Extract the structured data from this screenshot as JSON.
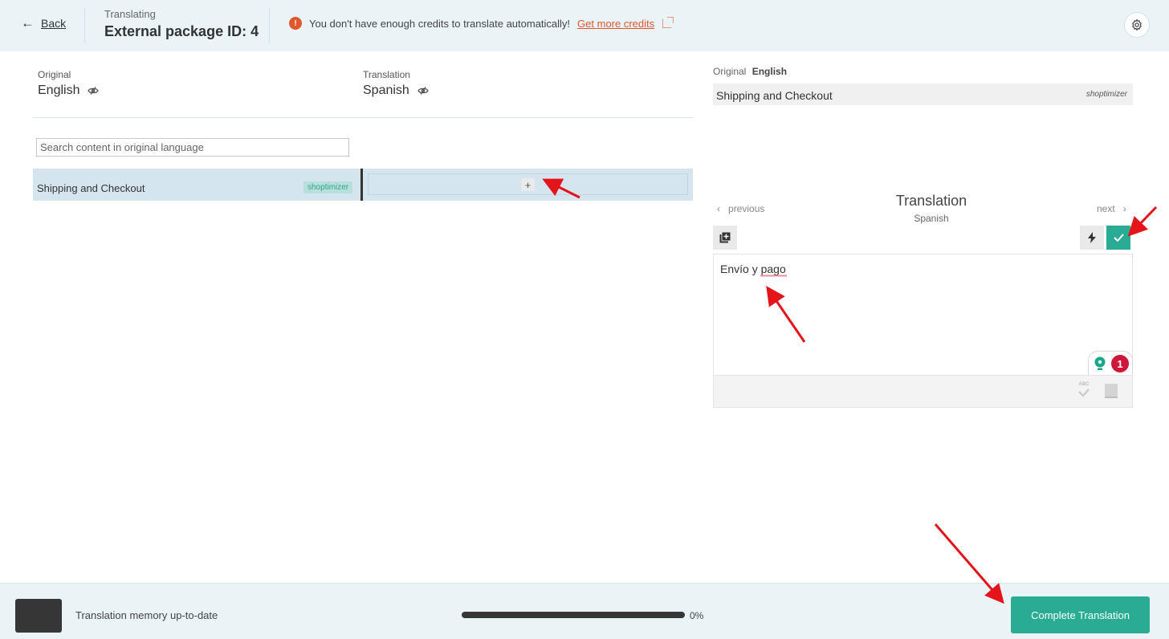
{
  "header": {
    "back_label": "Back",
    "subtitle": "Translating",
    "title": "External package ID: 4",
    "warning_text": "You don't have enough credits to translate automatically!",
    "warning_link": "Get more credits",
    "warning_icon": "!"
  },
  "left": {
    "original_caption": "Original",
    "original_language": "English",
    "translation_caption": "Translation",
    "translation_language": "Spanish",
    "search_placeholder": "Search content in original language",
    "rows": [
      {
        "source": "Shipping and Checkout",
        "tag": "shoptimizer",
        "target": "",
        "add_label": "+"
      }
    ]
  },
  "right": {
    "original_caption": "Original",
    "original_language": "English",
    "original_text": "Shipping and Checkout",
    "context": "shoptimizer",
    "prev_label": "previous",
    "next_label": "next",
    "translation_title": "Translation",
    "translation_language": "Spanish",
    "translation_value": "Envío y pago",
    "grammar_issue_count": "1",
    "spellcheck_label": "ABC"
  },
  "footer": {
    "memory_status": "Translation memory up-to-date",
    "progress_percent": 0,
    "progress_label": "0%",
    "complete_label": "Complete Translation"
  },
  "colors": {
    "accent": "#2aac94",
    "warning": "#e0562e",
    "header_bg": "#eaf3f6",
    "selected_row": "#d4e5ef",
    "error_badge": "#d0173b"
  }
}
